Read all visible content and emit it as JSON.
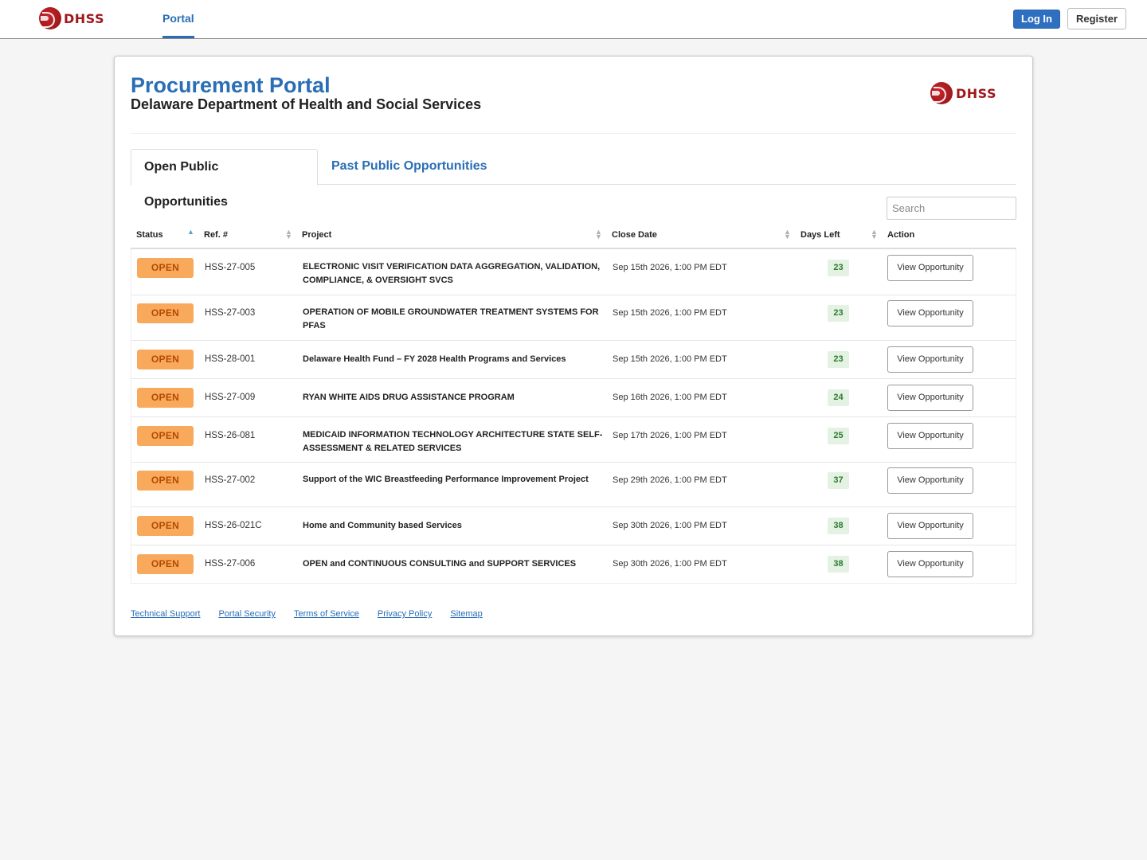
{
  "navbar": {
    "logo_text": "DHSS",
    "portal_link": "Portal",
    "login_label": "Log In",
    "register_label": "Register"
  },
  "header": {
    "title": "Procurement Portal",
    "subtitle": "Delaware Department of Health and Social Services",
    "logo_text": "DHSS"
  },
  "tabs": [
    {
      "label": "Open Public Opportunities",
      "active": true
    },
    {
      "label": "Past Public Opportunities",
      "active": false
    }
  ],
  "search": {
    "placeholder": "Search",
    "value": ""
  },
  "table": {
    "columns": [
      "Status",
      "Ref. #",
      "Project",
      "Close Date",
      "Days Left",
      "Action"
    ],
    "sorted_column": "Status",
    "sort_direction": "ascending",
    "rows": [
      {
        "status": "OPEN",
        "ref": "HSS-27-005",
        "project": "ELECTRONIC VISIT VERIFICATION DATA AGGREGATION, VALIDATION, COMPLIANCE, & OVERSIGHT SVCS",
        "close_date": "Sep 15th 2026, 1:00 PM EDT",
        "days_left": "23",
        "action": "View Opportunity"
      },
      {
        "status": "OPEN",
        "ref": "HSS-27-003",
        "project": "OPERATION OF MOBILE GROUNDWATER TREATMENT SYSTEMS FOR PFAS",
        "close_date": "Sep 15th 2026, 1:00 PM EDT",
        "days_left": "23",
        "action": "View Opportunity"
      },
      {
        "status": "OPEN",
        "ref": "HSS-28-001",
        "project": "Delaware Health Fund – FY 2028 Health Programs and Services",
        "close_date": "Sep 15th 2026, 1:00 PM EDT",
        "days_left": "23",
        "action": "View Opportunity"
      },
      {
        "status": "OPEN",
        "ref": "HSS-27-009",
        "project": "RYAN WHITE AIDS DRUG ASSISTANCE PROGRAM",
        "close_date": "Sep 16th 2026, 1:00 PM EDT",
        "days_left": "24",
        "action": "View Opportunity"
      },
      {
        "status": "OPEN",
        "ref": "HSS-26-081",
        "project": "MEDICAID INFORMATION TECHNOLOGY ARCHITECTURE STATE SELF-ASSESSMENT & RELATED SERVICES",
        "close_date": "Sep 17th 2026, 1:00 PM EDT",
        "days_left": "25",
        "action": "View Opportunity"
      },
      {
        "status": "OPEN",
        "ref": "HSS-27-002",
        "project": "Support of the WIC Breastfeeding Performance Improvement Project",
        "close_date": "Sep 29th 2026, 1:00 PM EDT",
        "days_left": "37",
        "action": "View Opportunity"
      },
      {
        "status": "OPEN",
        "ref": "HSS-26-021C",
        "project": "Home and Community based Services",
        "close_date": "Sep 30th 2026, 1:00 PM EDT",
        "days_left": "38",
        "action": "View Opportunity"
      },
      {
        "status": "OPEN",
        "ref": "HSS-27-006",
        "project": "OPEN and CONTINUOUS CONSULTING and SUPPORT SERVICES",
        "close_date": "Sep 30th 2026, 1:00 PM EDT",
        "days_left": "38",
        "action": "View Opportunity"
      }
    ]
  },
  "footer": {
    "links": [
      "Technical Support",
      "Portal Security",
      "Terms of Service",
      "Privacy Policy",
      "Sitemap"
    ]
  },
  "colors": {
    "brand_red": "#a0181c",
    "link_blue": "#2a6eb5",
    "open_badge": "#f9a95c",
    "days_badge": "#e3f2e3"
  }
}
